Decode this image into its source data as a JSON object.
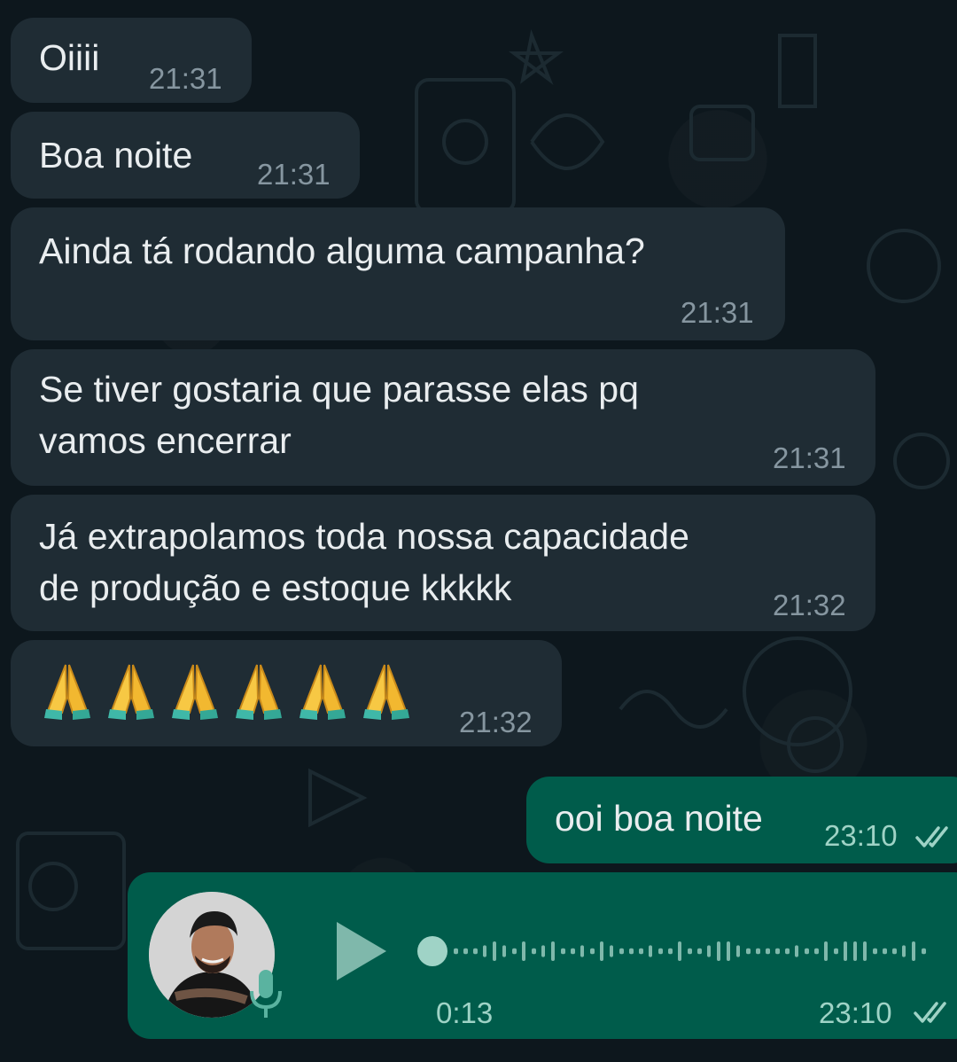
{
  "incoming": [
    {
      "text": "Oiiii",
      "time": "21:31"
    },
    {
      "text": "Boa noite",
      "time": "21:31"
    },
    {
      "text": "Ainda tá rodando alguma campanha?",
      "time": "21:31"
    },
    {
      "text": "Se tiver gostaria que parasse elas pq\nvamos encerrar",
      "time": "21:31"
    },
    {
      "text": "Já extrapolamos toda nossa capacidade\nde produção e estoque kkkkk",
      "time": "21:32"
    },
    {
      "emoji": "🙏🙏🙏🙏🙏🙏",
      "time": "21:32"
    }
  ],
  "outgoing": [
    {
      "text": "ooi boa noite",
      "time": "23:10",
      "status_icon": "double-check-icon"
    },
    {
      "type": "voice",
      "duration": "0:13",
      "time": "23:10",
      "status_icon": "double-check-icon",
      "play_icon": "play-icon",
      "mic_icon": "mic-icon"
    }
  ],
  "colors": {
    "background": "#0b141a",
    "incoming_bubble": "#1f2c34",
    "outgoing_bubble": "#005c4b",
    "timestamp": "#8696a0",
    "read_ticks": "#9fd3c6"
  }
}
